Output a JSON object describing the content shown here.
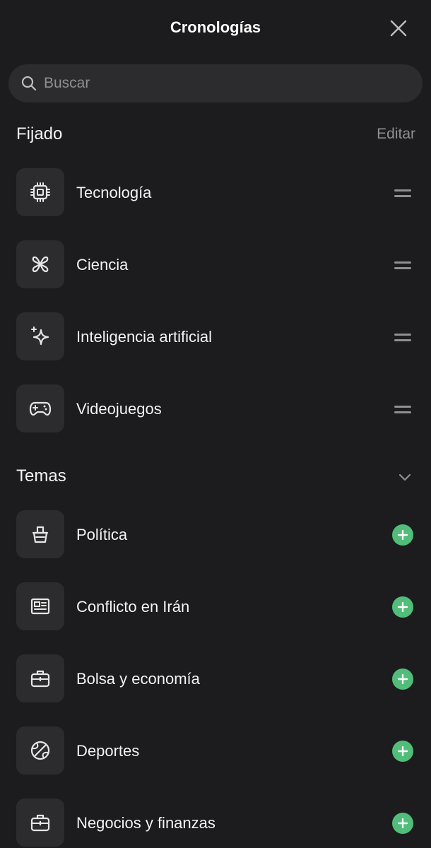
{
  "header": {
    "title": "Cronologías"
  },
  "search": {
    "placeholder": "Buscar"
  },
  "pinned": {
    "title": "Fijado",
    "edit_label": "Editar",
    "items": [
      {
        "label": "Tecnología",
        "icon": "chip-icon"
      },
      {
        "label": "Ciencia",
        "icon": "atom-icon"
      },
      {
        "label": "Inteligencia artificial",
        "icon": "sparkle-icon"
      },
      {
        "label": "Videojuegos",
        "icon": "gamepad-icon"
      }
    ]
  },
  "topics": {
    "title": "Temas",
    "items": [
      {
        "label": "Política",
        "icon": "ballot-box-icon"
      },
      {
        "label": "Conflicto en Irán",
        "icon": "newspaper-icon"
      },
      {
        "label": "Bolsa y economía",
        "icon": "briefcase-icon"
      },
      {
        "label": "Deportes",
        "icon": "ball-icon"
      },
      {
        "label": "Negocios y finanzas",
        "icon": "briefcase-icon"
      }
    ]
  },
  "colors": {
    "background": "#1c1c1e",
    "tile": "#2c2c2e",
    "accent_add": "#4fbe79",
    "muted": "#8e8e93"
  }
}
